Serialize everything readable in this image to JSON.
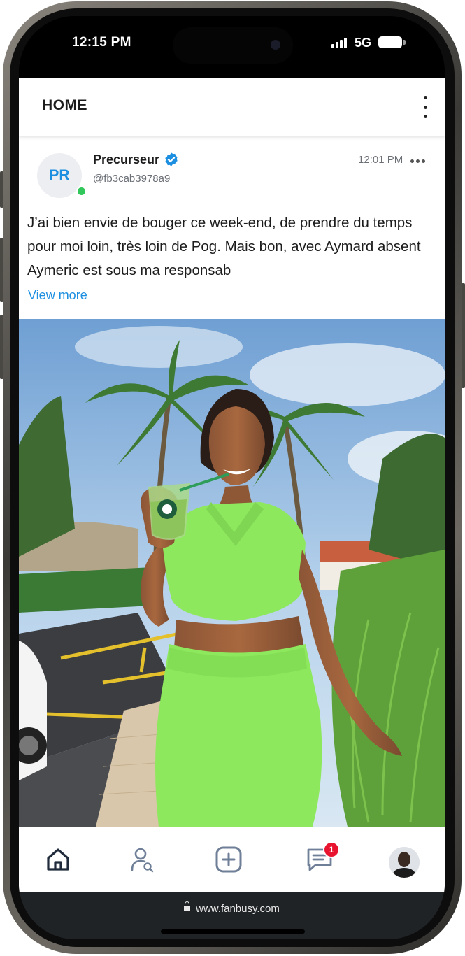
{
  "status_bar": {
    "time": "12:15 PM",
    "network": "5G"
  },
  "header": {
    "title": "HOME"
  },
  "post": {
    "avatar_initials": "PR",
    "author_name": "Precurseur",
    "handle": "@fb3cab3978a9",
    "time": "12:01 PM",
    "text": "J’ai bien envie de bouger ce week-end, de prendre du temps pour moi loin, très loin de Pog. Mais bon, avec Aymard absent Aymeric est sous ma responsab",
    "view_more": "View more"
  },
  "bottom_nav": {
    "items": [
      "home-icon",
      "search-user-icon",
      "add-post-icon",
      "messages-icon",
      "profile-avatar"
    ],
    "messages_badge": "1"
  },
  "browser": {
    "url": "www.fanbusy.com"
  },
  "colors": {
    "accent": "#1d8fe1",
    "online": "#31c75a",
    "badge": "#e8142f",
    "outfit": "#8ee85e"
  }
}
